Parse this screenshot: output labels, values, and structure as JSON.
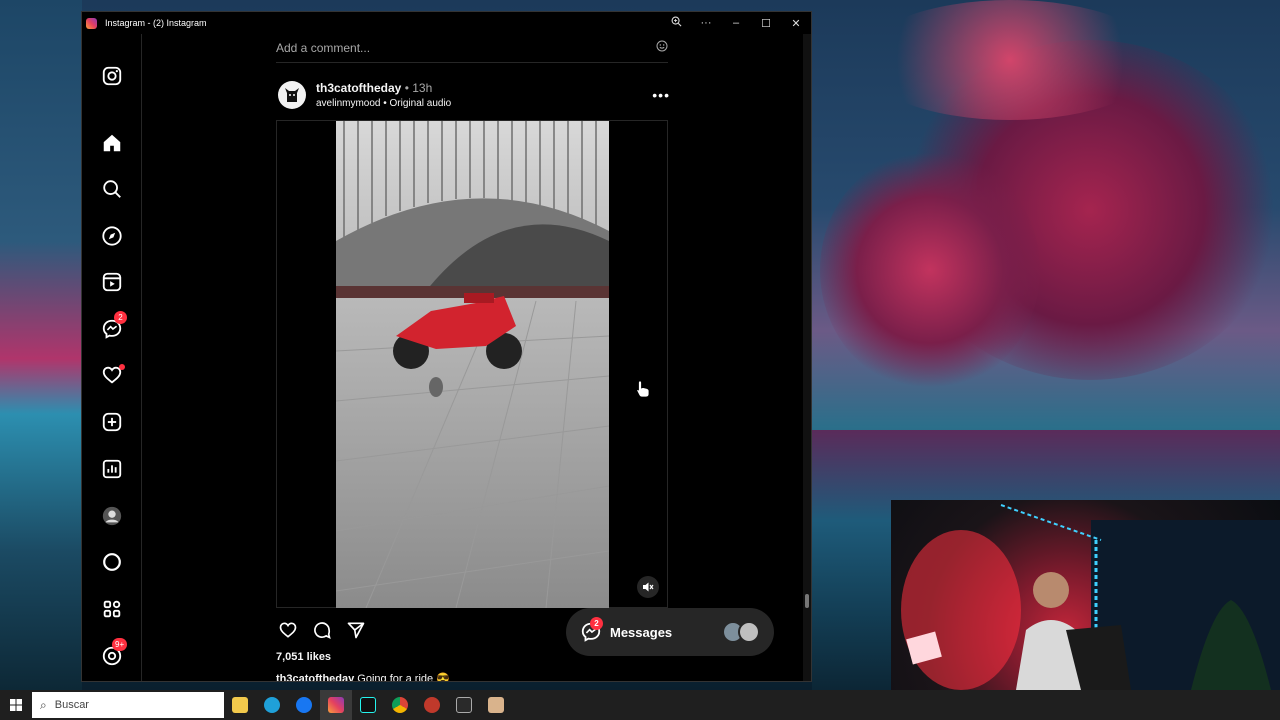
{
  "window": {
    "title": "Instagram - (2) Instagram",
    "zoom_icon": "zoom-in-icon",
    "more_icon": "more-options-icon",
    "minimize": "–",
    "maximize": "☐",
    "close": "✕"
  },
  "sidebar": {
    "items": [
      {
        "name": "instagram-logo-icon"
      },
      {
        "name": "home-icon"
      },
      {
        "name": "search-icon"
      },
      {
        "name": "explore-icon"
      },
      {
        "name": "reels-icon"
      },
      {
        "name": "messenger-icon",
        "badge": "2"
      },
      {
        "name": "notifications-heart-icon",
        "dot": true
      },
      {
        "name": "create-icon"
      },
      {
        "name": "dashboard-icon"
      },
      {
        "name": "profile-avatar"
      },
      {
        "name": "threads-icon"
      },
      {
        "name": "more-icon"
      },
      {
        "name": "meta-threads-icon",
        "badge": "9+"
      }
    ]
  },
  "feed": {
    "comment_placeholder": "Add a comment...",
    "post": {
      "username": "th3catoftheday",
      "time": " • 13h",
      "audio": "avelinmymood • Original audio",
      "likes": "7,051 likes",
      "caption_user": "th3catoftheday",
      "caption_text": " Going for a ride 😎"
    }
  },
  "messages": {
    "label": "Messages",
    "badge": "2"
  },
  "taskbar": {
    "search_placeholder": "Buscar",
    "apps": [
      {
        "name": "file-explorer-icon",
        "color": "#f2c94c"
      },
      {
        "name": "edge-icon",
        "color": "#1fa0d8"
      },
      {
        "name": "facebook-icon",
        "color": "#1877f2"
      },
      {
        "name": "instagram-icon",
        "color": "#e4405f",
        "active": true
      },
      {
        "name": "tiktok-icon",
        "color": "#111111"
      },
      {
        "name": "chrome-icon",
        "color": "#f4b400"
      },
      {
        "name": "obs-icon",
        "color": "#c0392b"
      },
      {
        "name": "epic-games-icon",
        "color": "#2a2a2a"
      },
      {
        "name": "photo-app-icon",
        "color": "#d9b38c"
      }
    ]
  }
}
